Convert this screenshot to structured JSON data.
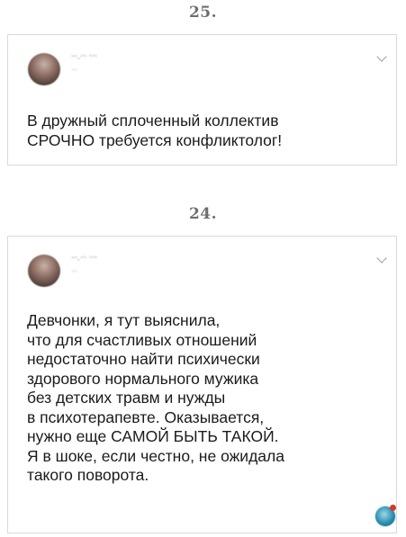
{
  "posts": [
    {
      "number": "25.",
      "author": "ʻʻʻ-ʻʼʻ ʼʻʼʻ",
      "handle": "ʻʻʻʻ",
      "text": "В дружный сплоченный коллектив\nСРОЧНО требуется конфликтолог!"
    },
    {
      "number": "24.",
      "author": "ʻʻʻ-ʻʼʻ ʼʻʼʻ",
      "handle": "ʻʻʻʻ",
      "text": "Девчонки, я тут выяснила,\nчто для счастливых отношений\nнедостаточно найти психически\nздорового нормального мужика\nбез детских травм и нужды\nв психотерапевте. Оказывается,\nнужно еще САМОЙ БЫТЬ ТАКОЙ.\nЯ в шоке, если честно, не ожидала\nтакого поворота."
    }
  ],
  "icons": {
    "chevron": "chevron-down-icon",
    "avatar": "avatar",
    "badge": "globe-badge-icon"
  }
}
